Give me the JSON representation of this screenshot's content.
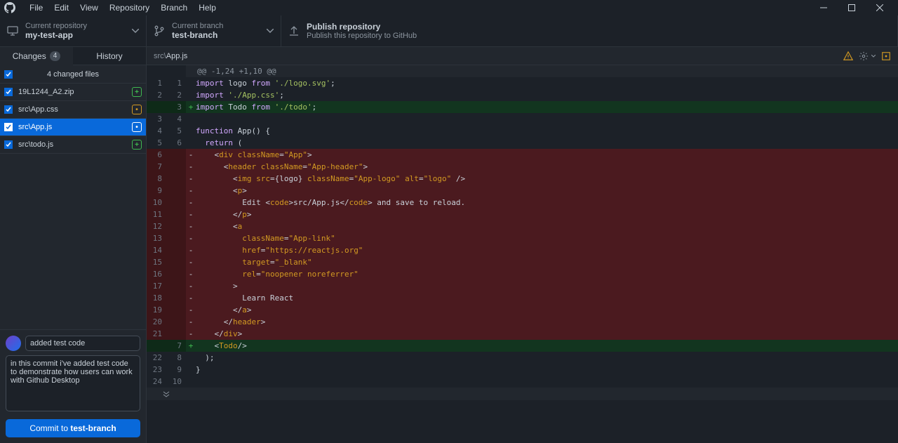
{
  "menu": {
    "items": [
      "File",
      "Edit",
      "View",
      "Repository",
      "Branch",
      "Help"
    ]
  },
  "toolbar": {
    "repo": {
      "label": "Current repository",
      "value": "my-test-app"
    },
    "branch": {
      "label": "Current branch",
      "value": "test-branch"
    },
    "publish": {
      "label": "Publish repository",
      "value": "Publish this repository to GitHub"
    }
  },
  "tabs": {
    "changes": "Changes",
    "count": "4",
    "history": "History"
  },
  "filesHeader": "4 changed files",
  "files": [
    {
      "name": "19L1244_A2.zip",
      "badge": "+",
      "badgeClass": "badge-add"
    },
    {
      "name": "src\\App.css",
      "badge": "•",
      "badgeClass": "badge-mod"
    },
    {
      "name": "src\\App.js",
      "badge": "•",
      "badgeClass": "badge-mod2",
      "selected": true
    },
    {
      "name": "src\\todo.js",
      "badge": "+",
      "badgeClass": "badge-add"
    }
  ],
  "commit": {
    "summary": "added test code",
    "description": "in this commit i've added test code to demonstrate how users can work with Github Desktop",
    "buttonPrefix": "Commit to ",
    "buttonBranch": "test-branch"
  },
  "diff": {
    "pathDir": "src\\",
    "pathFile": "App.js",
    "hunk": "@@ -1,24 +1,10 @@",
    "lines": [
      {
        "old": "1",
        "new": "1",
        "type": "ctx",
        "html": "<span class='tk-kw'>import</span> <span class='tk-var'>logo</span> <span class='tk-kw'>from</span> <span class='tk-str'>'./logo.svg'</span>;"
      },
      {
        "old": "2",
        "new": "2",
        "type": "ctx",
        "html": "<span class='tk-kw'>import</span> <span class='tk-str'>'./App.css'</span>;"
      },
      {
        "old": "",
        "new": "3",
        "type": "add",
        "html": "<span class='tk-kw'>import</span> <span class='tk-var'>Todo</span> <span class='tk-kw'>from</span> <span class='tk-str'>'./todo'</span>;"
      },
      {
        "old": "3",
        "new": "4",
        "type": "ctx",
        "html": ""
      },
      {
        "old": "4",
        "new": "5",
        "type": "ctx",
        "html": "<span class='tk-kw'>function</span> <span class='tk-fn'>App</span>() {"
      },
      {
        "old": "5",
        "new": "6",
        "type": "ctx",
        "html": "  <span class='tk-kw'>return</span> ("
      },
      {
        "old": "6",
        "new": "",
        "type": "del",
        "html": "    &lt;<span class='tk-tag'>div</span> <span class='tk-attr'>className</span>=<span class='tk-str2'>\"App\"</span>&gt;"
      },
      {
        "old": "7",
        "new": "",
        "type": "del",
        "html": "      &lt;<span class='tk-tag'>header</span> <span class='tk-attr'>className</span>=<span class='tk-str2'>\"App-header\"</span>&gt;"
      },
      {
        "old": "8",
        "new": "",
        "type": "del",
        "html": "        &lt;<span class='tk-tag'>img</span> <span class='tk-attr'>src</span>={logo} <span class='tk-attr'>className</span>=<span class='tk-str2'>\"App-logo\"</span> <span class='tk-attr'>alt</span>=<span class='tk-str2'>\"logo\"</span> /&gt;"
      },
      {
        "old": "9",
        "new": "",
        "type": "del",
        "html": "        &lt;<span class='tk-tag'>p</span>&gt;"
      },
      {
        "old": "10",
        "new": "",
        "type": "del",
        "html": "          Edit &lt;<span class='tk-tag'>code</span>&gt;src/App.js&lt;/<span class='tk-tag'>code</span>&gt; and save to reload."
      },
      {
        "old": "11",
        "new": "",
        "type": "del",
        "html": "        &lt;/<span class='tk-tag'>p</span>&gt;"
      },
      {
        "old": "12",
        "new": "",
        "type": "del",
        "html": "        &lt;<span class='tk-tag'>a</span>"
      },
      {
        "old": "13",
        "new": "",
        "type": "del",
        "html": "          <span class='tk-attr'>className</span>=<span class='tk-str2'>\"App-link\"</span>"
      },
      {
        "old": "14",
        "new": "",
        "type": "del",
        "html": "          <span class='tk-attr'>href</span>=<span class='tk-str2'>\"https://reactjs.org\"</span>"
      },
      {
        "old": "15",
        "new": "",
        "type": "del",
        "html": "          <span class='tk-attr'>target</span>=<span class='tk-str2'>\"_blank\"</span>"
      },
      {
        "old": "16",
        "new": "",
        "type": "del",
        "html": "          <span class='tk-attr'>rel</span>=<span class='tk-str2'>\"noopener noreferrer\"</span>"
      },
      {
        "old": "17",
        "new": "",
        "type": "del",
        "html": "        &gt;"
      },
      {
        "old": "18",
        "new": "",
        "type": "del",
        "html": "          Learn React"
      },
      {
        "old": "19",
        "new": "",
        "type": "del",
        "html": "        &lt;/<span class='tk-tag'>a</span>&gt;"
      },
      {
        "old": "20",
        "new": "",
        "type": "del",
        "html": "      &lt;/<span class='tk-tag'>header</span>&gt;"
      },
      {
        "old": "21",
        "new": "",
        "type": "del",
        "html": "    &lt;/<span class='tk-tag'>div</span>&gt;"
      },
      {
        "old": "",
        "new": "7",
        "type": "add",
        "html": "    &lt;<span class='tk-tag'>Todo</span>/&gt;"
      },
      {
        "old": "22",
        "new": "8",
        "type": "ctx",
        "html": "  );"
      },
      {
        "old": "23",
        "new": "9",
        "type": "ctx",
        "html": "}"
      },
      {
        "old": "24",
        "new": "10",
        "type": "ctx",
        "html": ""
      }
    ]
  }
}
